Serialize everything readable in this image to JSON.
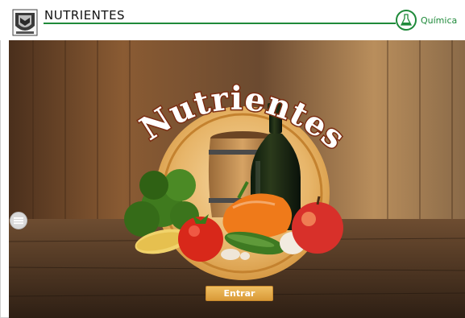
{
  "header": {
    "title": "NUTRIENTES",
    "subject": "Química",
    "logo_icon": "university-crest-icon",
    "subject_icon": "flask-icon"
  },
  "hero": {
    "title": "Nutrientes"
  },
  "actions": {
    "enter_label": "Entrar",
    "menu_icon": "menu-icon"
  },
  "colors": {
    "accent_green": "#1f8a3a",
    "button_orange": "#e2a547",
    "wood_dark": "#4b3422"
  }
}
